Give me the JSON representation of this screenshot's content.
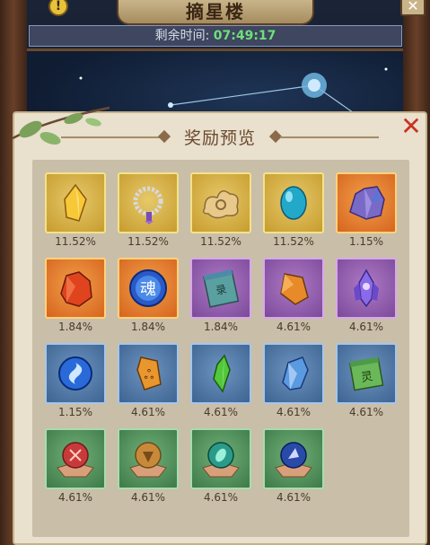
{
  "header": {
    "title": "摘星楼",
    "timer_label": "剩余时间:",
    "timer_value": "07:49:17"
  },
  "panel": {
    "title": "奖励预览"
  },
  "colors": {
    "timer_value": "#6fe07a",
    "close": "#c83222",
    "gold": "#c79c2e",
    "orange": "#d6641e",
    "purple": "#7a4a98",
    "blue": "#3d6492",
    "green": "#3d7a48"
  },
  "rewards": [
    {
      "icon": "gold-crystal-icon",
      "rarity": "gold",
      "chance": "11.52%"
    },
    {
      "icon": "prayer-beads-icon",
      "rarity": "gold",
      "chance": "11.52%"
    },
    {
      "icon": "cloud-ornament-icon",
      "rarity": "gold",
      "chance": "11.52%"
    },
    {
      "icon": "blue-gem-icon",
      "rarity": "gold",
      "chance": "11.52%"
    },
    {
      "icon": "purple-ore-icon",
      "rarity": "orange",
      "chance": "1.15%"
    },
    {
      "icon": "red-ore-icon",
      "rarity": "orange",
      "chance": "1.84%"
    },
    {
      "icon": "soul-orb-icon",
      "rarity": "orange",
      "chance": "1.84%"
    },
    {
      "icon": "scroll-icon",
      "rarity": "purple",
      "chance": "1.84%"
    },
    {
      "icon": "amber-shard-icon",
      "rarity": "purple",
      "chance": "4.61%"
    },
    {
      "icon": "violet-crystal-icon",
      "rarity": "purple",
      "chance": "4.61%"
    },
    {
      "icon": "swirl-orb-icon",
      "rarity": "blue",
      "chance": "1.15%"
    },
    {
      "icon": "rune-token-icon",
      "rarity": "blue",
      "chance": "4.61%"
    },
    {
      "icon": "green-shard-icon",
      "rarity": "blue",
      "chance": "4.61%"
    },
    {
      "icon": "ice-crystal-icon",
      "rarity": "blue",
      "chance": "4.61%"
    },
    {
      "icon": "green-scroll-icon",
      "rarity": "blue",
      "chance": "4.61%"
    },
    {
      "icon": "red-sphere-icon",
      "rarity": "green",
      "chance": "4.61%"
    },
    {
      "icon": "bronze-sphere-icon",
      "rarity": "green",
      "chance": "4.61%"
    },
    {
      "icon": "teal-sphere-icon",
      "rarity": "green",
      "chance": "4.61%"
    },
    {
      "icon": "navy-sphere-icon",
      "rarity": "green",
      "chance": "4.61%"
    }
  ]
}
